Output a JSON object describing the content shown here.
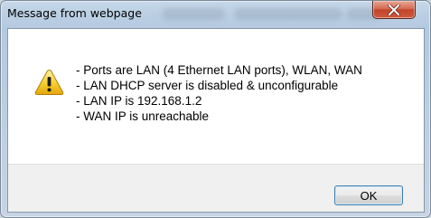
{
  "dialog": {
    "title": "Message from webpage",
    "icon": "warning-icon",
    "message_lines": [
      "- Ports are LAN (4 Ethernet LAN ports), WLAN, WAN",
      "- LAN DHCP server is disabled & unconfigurable",
      "- LAN IP is 192.168.1.2",
      "- WAN IP is unreachable"
    ],
    "ok_label": "OK",
    "close_icon": "close-icon"
  },
  "colors": {
    "close_button": "#c4442b",
    "warning_yellow": "#f6cf2e",
    "ok_border": "#3c7fb1"
  }
}
